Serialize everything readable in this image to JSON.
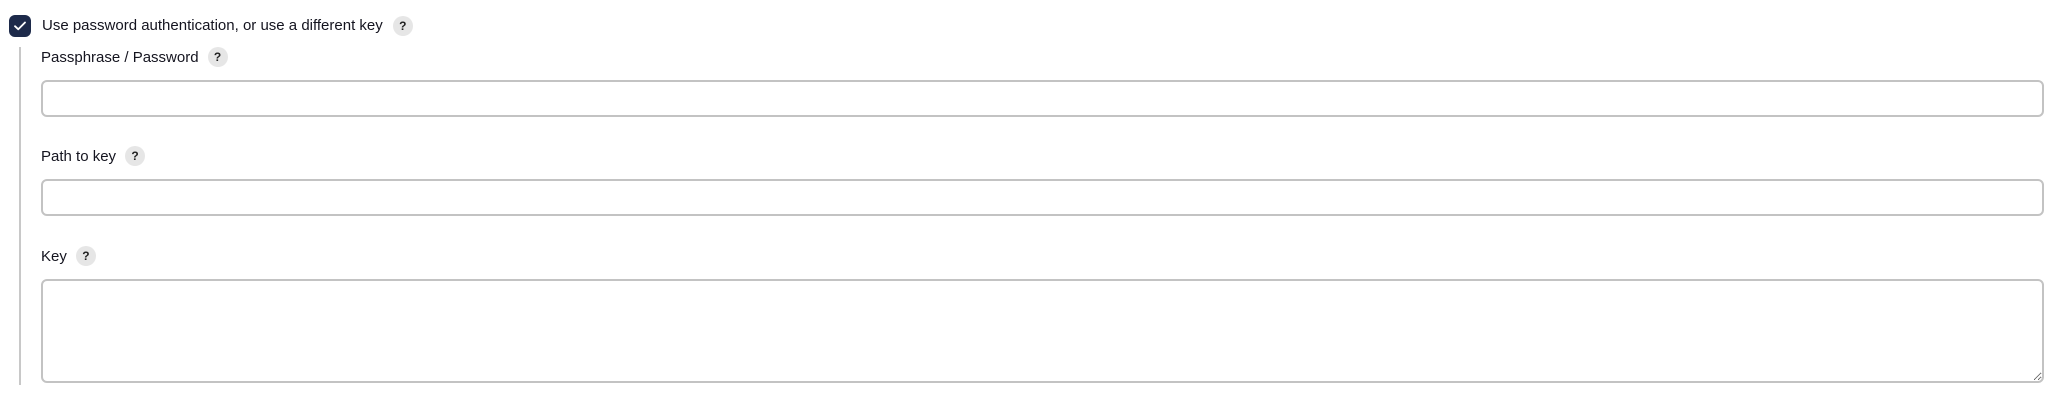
{
  "auth": {
    "use_password_label": "Use password authentication, or use a different key",
    "use_password_checked": true,
    "help_symbol": "?"
  },
  "fields": {
    "passphrase": {
      "label": "Passphrase / Password",
      "value": "",
      "placeholder": ""
    },
    "path_to_key": {
      "label": "Path to key",
      "value": "",
      "placeholder": ""
    },
    "key": {
      "label": "Key",
      "value": "",
      "placeholder": ""
    }
  },
  "colors": {
    "checkbox_fill": "#1d2a4a",
    "help_badge_bg": "#e6e6e6",
    "input_border": "#c3c3c3",
    "nest_line": "#c8c8c8"
  },
  "icons": {
    "checkbox": "checkmark-icon",
    "help": "help-question-icon",
    "resize": "resize-grip-icon"
  }
}
